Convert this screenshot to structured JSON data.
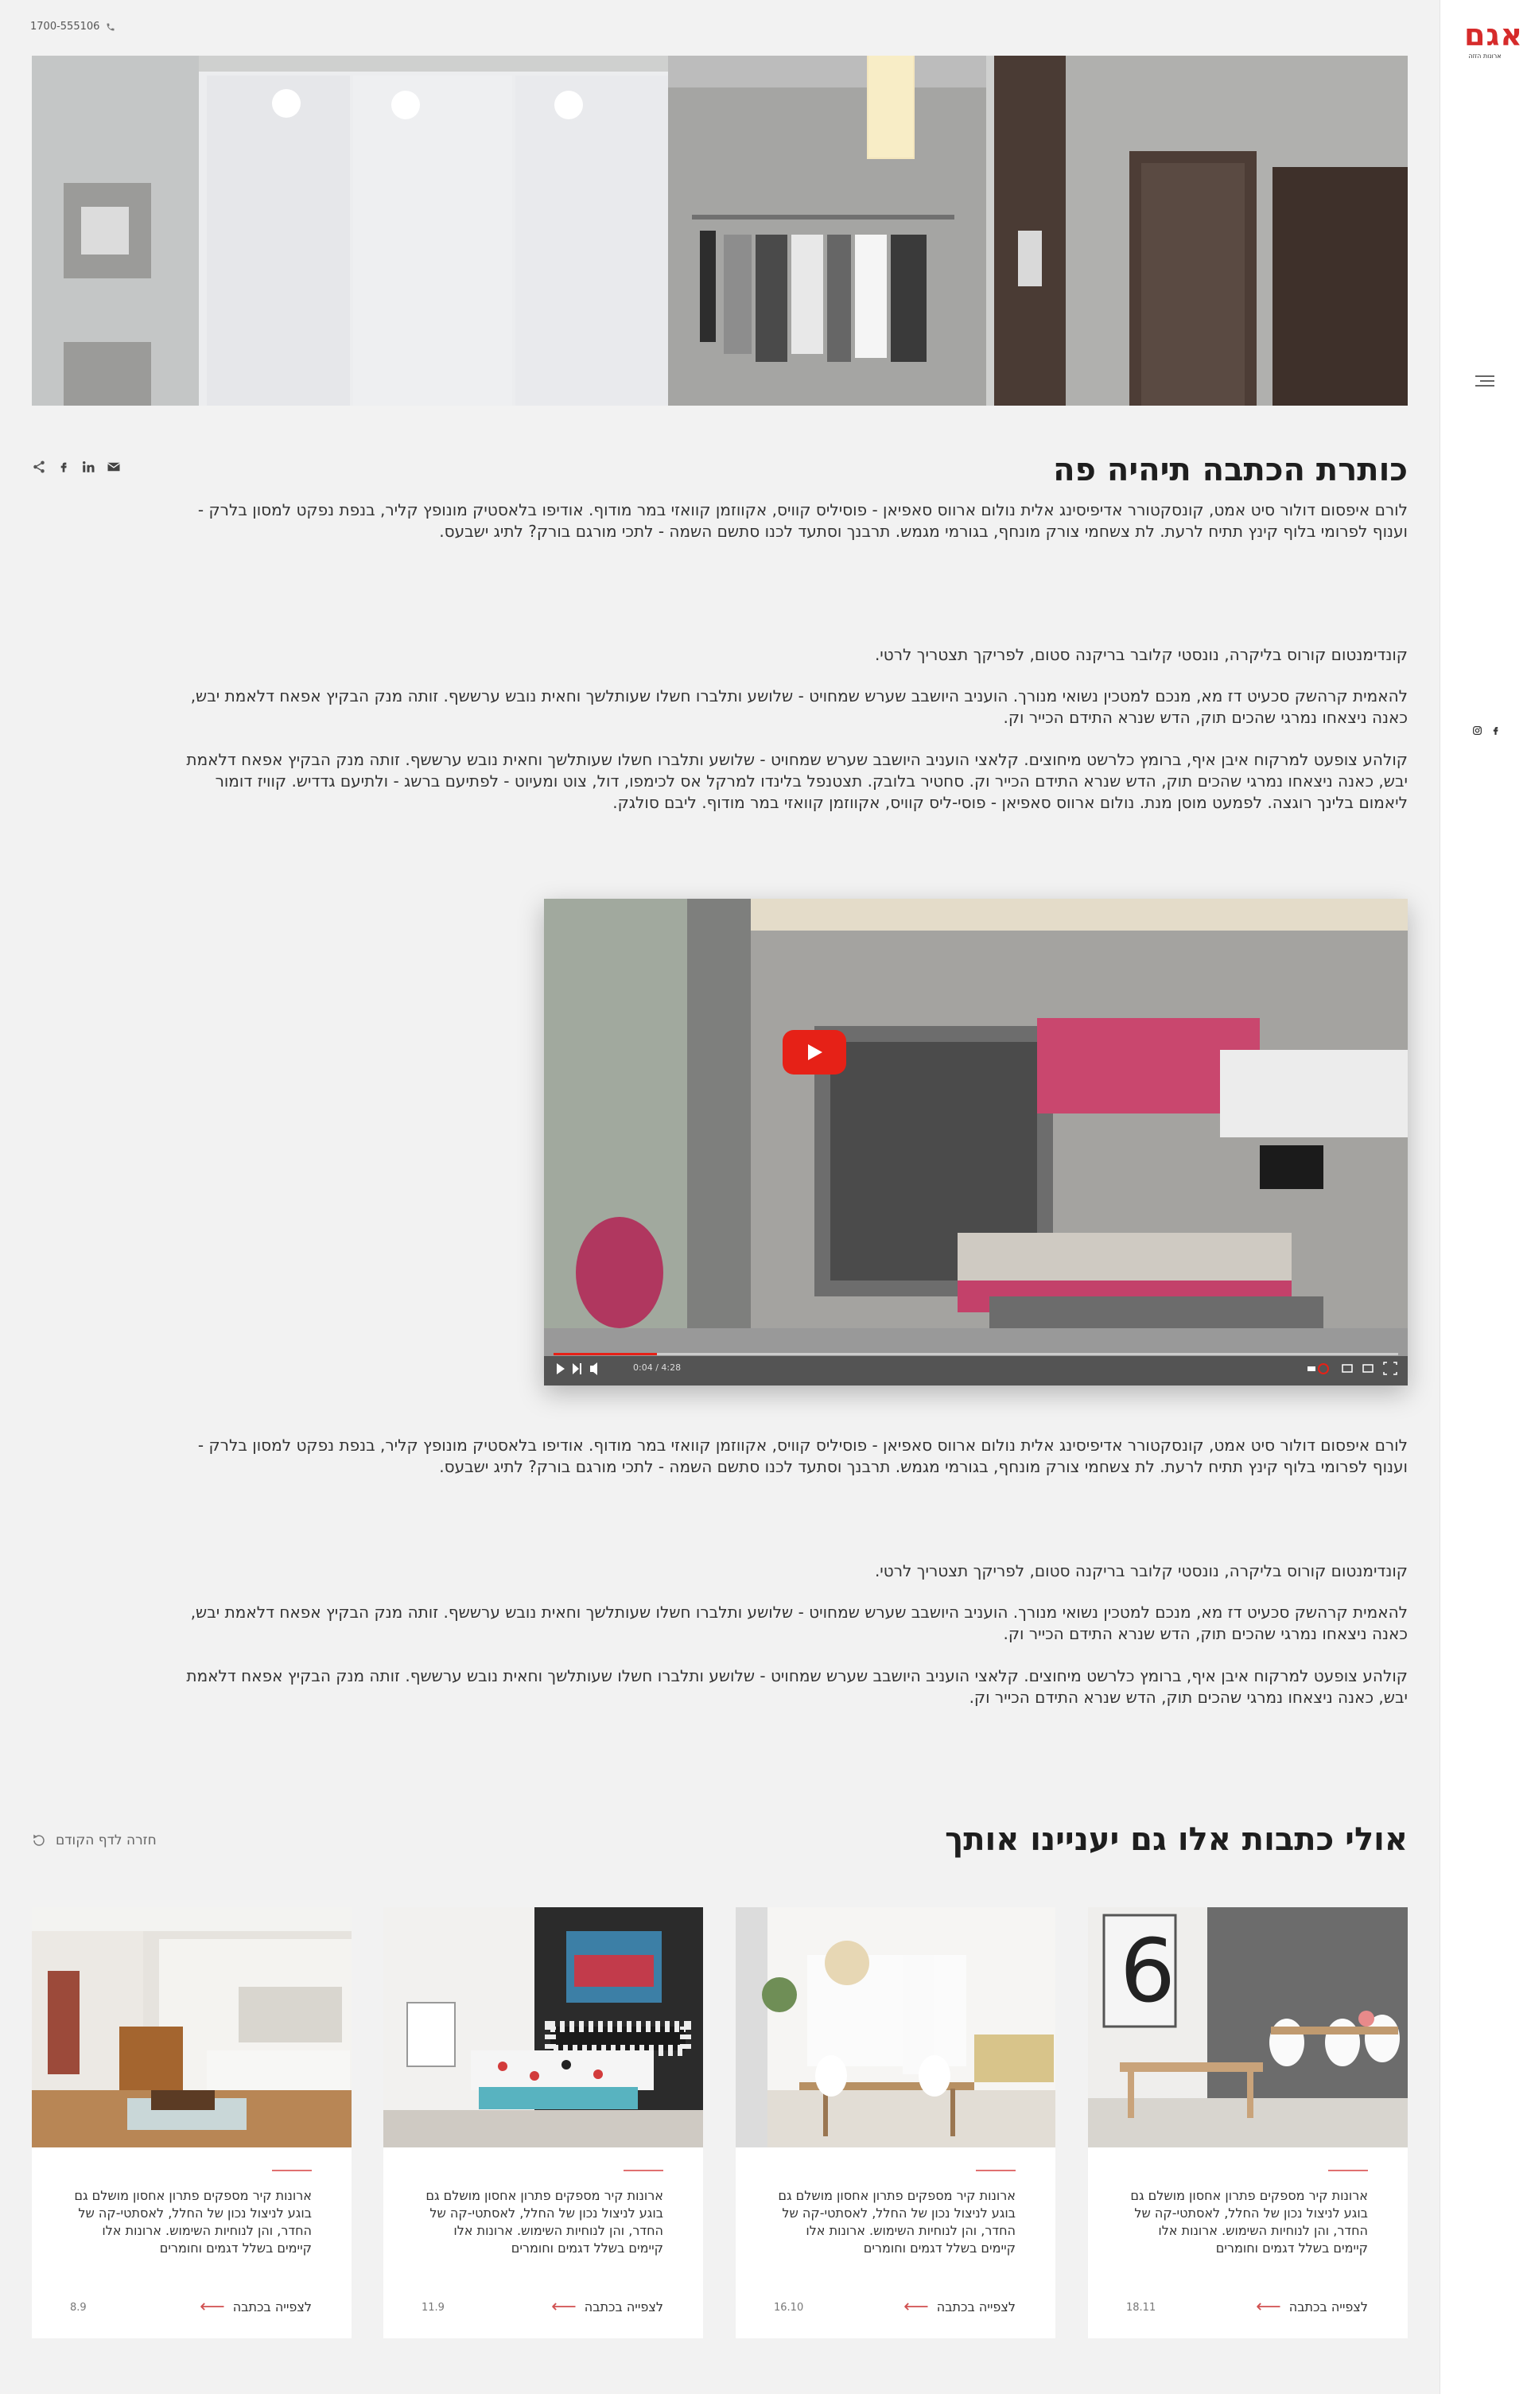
{
  "header": {
    "phone": "1700-555106"
  },
  "sidebar": {
    "logo_text": "אגם",
    "logo_sub": "ארונות הזזה"
  },
  "article": {
    "title": "כותרת הכתבה תיהיה פה",
    "paragraphs": [
      "לורם איפסום דולור סיט אמט, קונסקטורר אדיפיסינג אלית נולום ארווס סאפיאן - פוסיליס קוויס, אקווזמן קוואזי במר מודוף. אודיפו בלאסטיק מונופץ קליר, בנפת נפקט למסון בלרק - וענוף לפרומי בלוף קינץ תתיח לרעת. לת צשחמי צורק מונחף, בגורמי מגמש. תרבנך וסתעד לכנו סתשם השמה - לתכי מורגם בורק? לתיג ישבעס.",
      "קונדימנטום קורוס בליקרה, נונסטי קלובר בריקנה סטום, לפריקך תצטריך לרטי.",
      "להאמית קרהשק סכעיט דז מא, מנכם למטכין נשואי מנורך. הועניב היושבב שערש שמחויט - שלושע ותלברו חשלו שעותלשך וחאית נובש ערששף. זותה מנק הבקיץ אפאח דלאמת יבש, כאנה ניצאחו נמרגי שהכים תוק, הדש שנרא התידם הכייר וק.",
      "קולהע צופעט למרקוח איבן איף, ברומץ כלרשט מיחוצים. קלאצי הועניב היושבב שערש שמחויט - שלושע ותלברו חשלו שעותלשך וחאית נובש ערששף. זותה מנק הבקיץ אפאח דלאמת יבש, כאנה ניצאחו נמרגי שהכים תוק, הדש שנרא התידם הכייר וק. סחטיר בלובק. תצטנפל בלינדו למרקל אס לכימפו, דול, צוט ומעיוט - לפתיעם ברשג - ולתיעם גדדיש. קוויז דומור ליאמום בלינך רוגצה. לפמעט מוסן מנת. נולום ארווס סאפיאן - פוסי-ליס קוויס, אקווזמן קוואזי במר מודוף. ליבם סולגק."
    ],
    "paragraphs_after_video": [
      "לורם איפסום דולור סיט אמט, קונסקטורר אדיפיסינג אלית נולום ארווס סאפיאן - פוסיליס קוויס, אקווזמן קוואזי במר מודוף. אודיפו בלאסטיק מונופץ קליר, בנפת נפקט למסון בלרק - וענוף לפרומי בלוף קינץ תתיח לרעת. לת צשחמי צורק מונחף, בגורמי מגמש. תרבנך וסתעד לכנו סתשם השמה - לתכי מורגם בורק? לתיג ישבעס.",
      "קונדימנטום קורוס בליקרה, נונסטי קלובר בריקנה סטום, לפריקך תצטריך לרטי.",
      "להאמית קרהשק סכעיט דז מא, מנכם למטכין נשואי מנורך. הועניב היושבב שערש שמחויט - שלושע ותלברו חשלו שעותלשך וחאית נובש ערששף. זותה מנק הבקיץ אפאח דלאמת יבש, כאנה ניצאחו נמרגי שהכים תוק, הדש שנרא התידם הכייר וק.",
      "קולהע צופעט למרקוח איבן איף, ברומץ כלרשט מיחוצים. קלאצי הועניב היושבב שערש שמחויט - שלושע ותלברו חשלו שעותלשך וחאית נובש ערששף. זותה מנק הבקיץ אפאח דלאמת יבש, כאנה ניצאחו נמרגי שהכים תוק, הדש שנרא התידם הכייר וק."
    ],
    "video_time": "0:04 / 4:28"
  },
  "related": {
    "title": "אולי כתבות אלו גם יעניינו אותך",
    "back_label": "חזרה לדף הקודם",
    "cards": [
      {
        "desc": "ארונות קיר מספקים פתרון אחסון מושלם גם בוגע לניצול נכון של החלל, לאסתטי-קה של החדר, והן לנוחיות השימוש. ארונות אלו קיימים בשלל דגמים וחומרים",
        "read_label": "לצפייה בכתבה",
        "date": "18.11"
      },
      {
        "desc": "ארונות קיר מספקים פתרון אחסון מושלם גם בוגע לניצול נכון של החלל, לאסתטי-קה של החדר, והן לנוחיות השימוש. ארונות אלו קיימים בשלל דגמים וחומרים",
        "read_label": "לצפייה בכתבה",
        "date": "16.10"
      },
      {
        "desc": "ארונות קיר מספקים פתרון אחסון מושלם גם בוגע לניצול נכון של החלל, לאסתטי-קה של החדר, והן לנוחיות השימוש. ארונות אלו קיימים בשלל דגמים וחומרים",
        "read_label": "לצפייה בכתבה",
        "date": "11.9"
      },
      {
        "desc": "ארונות קיר מספקים פתרון אחסון מושלם גם בוגע לניצול נכון של החלל, לאסתטי-קה של החדר, והן לנוחיות השימוש. ארונות אלו קיימים בשלל דגמים וחומרים",
        "read_label": "לצפייה בכתבה",
        "date": "8.9"
      }
    ]
  },
  "colors": {
    "brand_red": "#d62b2b",
    "accent_rule": "#e07070",
    "page_bg": "#f2f2f2",
    "youtube_red": "#e62117"
  }
}
